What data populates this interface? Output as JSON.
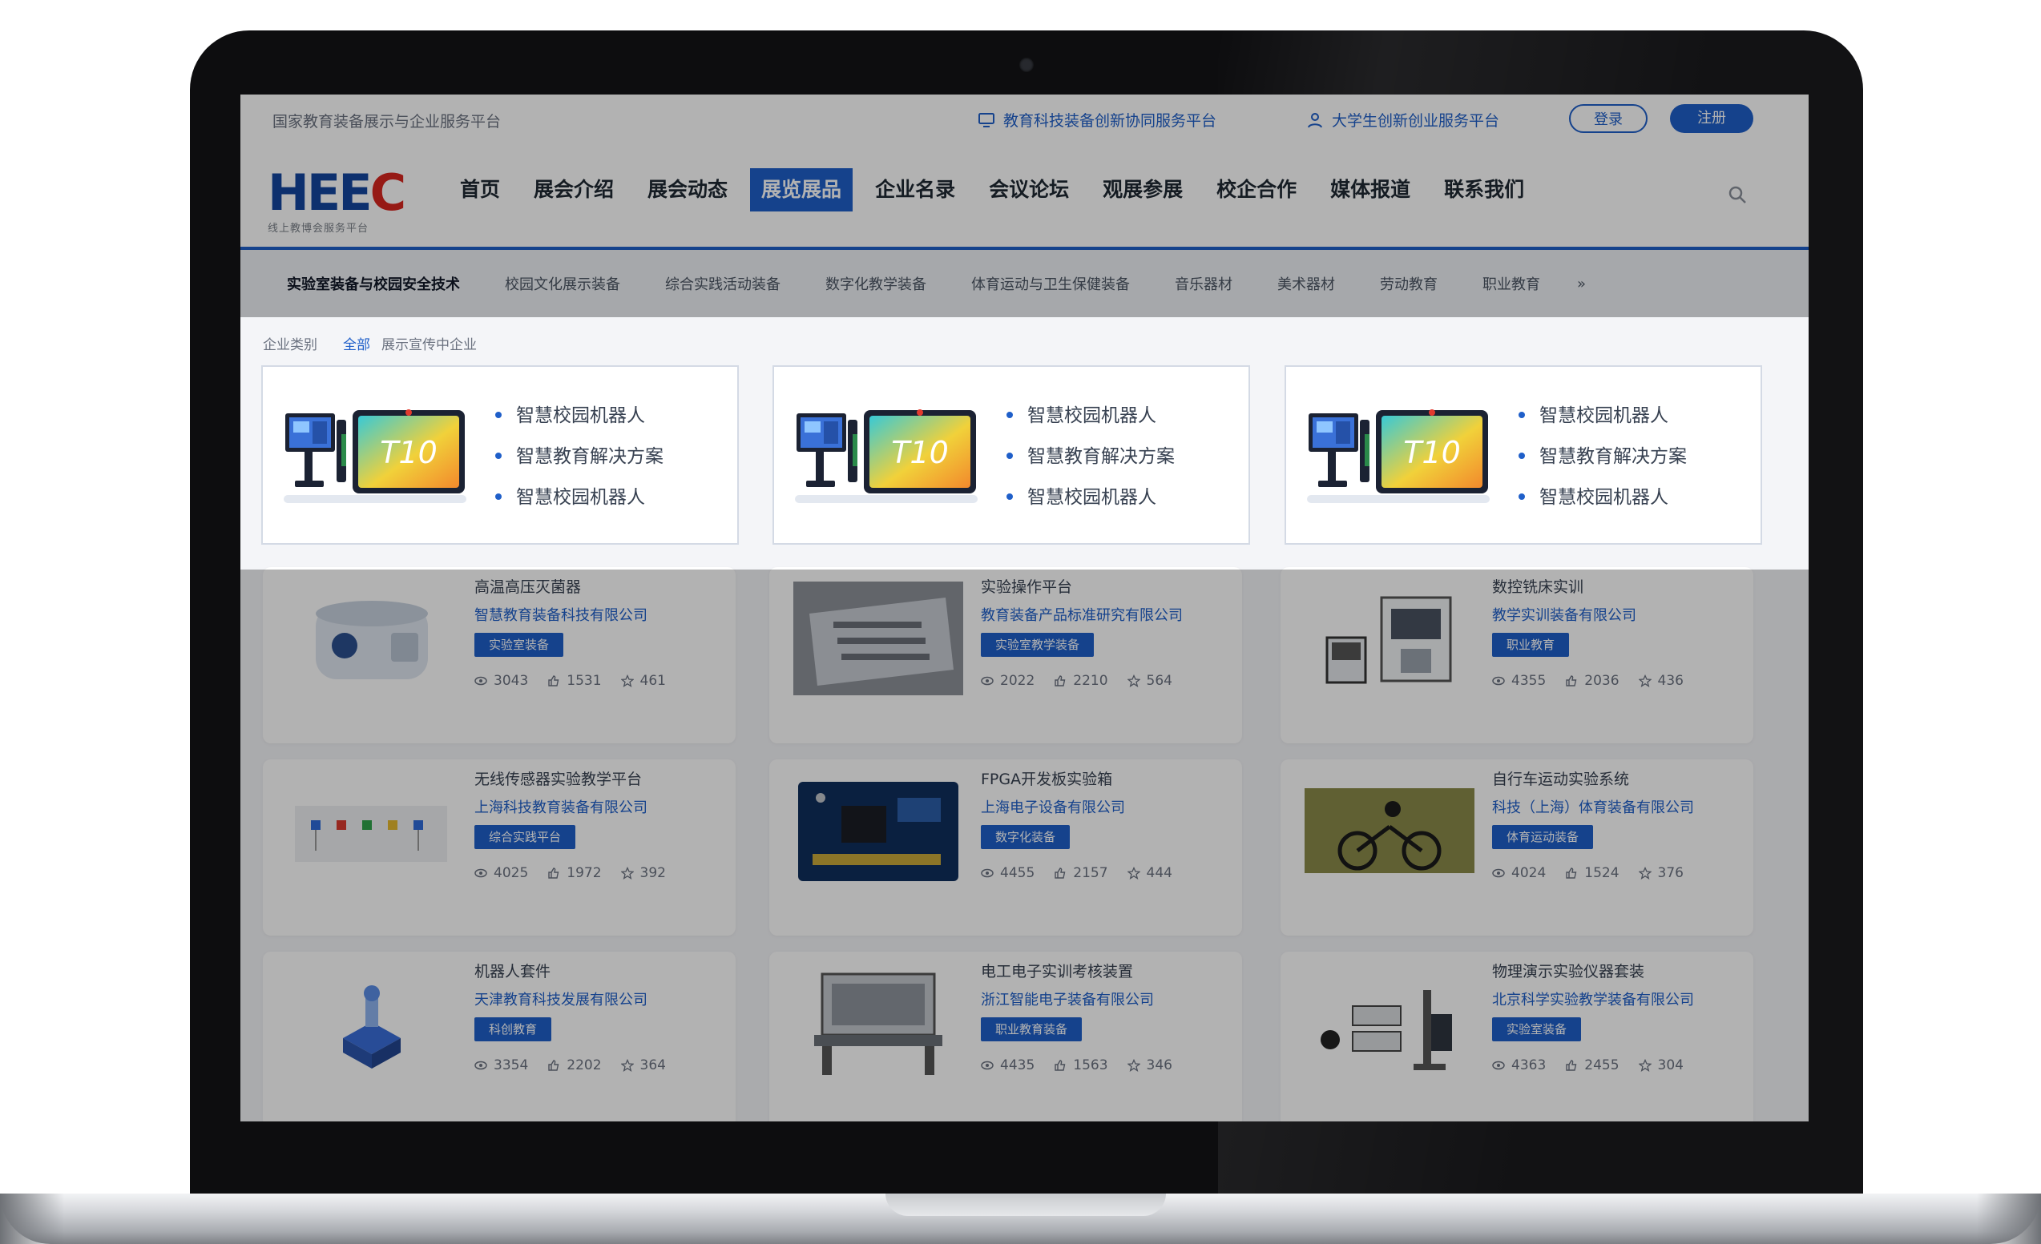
{
  "utility_bar": {
    "platform_name": "国家教育装备展示与企业服务平台",
    "link1": "教育科技装备创新协同服务平台",
    "link2": "大学生创新创业服务平台",
    "login": "登录",
    "register": "注册"
  },
  "logo": {
    "text_blue": "HEE",
    "text_red": "C",
    "subtitle": "线上教博会服务平台"
  },
  "nav": {
    "items": [
      "首页",
      "展会介绍",
      "展会动态",
      "展览展品",
      "企业名录",
      "会议论坛",
      "观展参展",
      "校企合作",
      "媒体报道",
      "联系我们"
    ],
    "active_index": 3
  },
  "subnav": {
    "items": [
      "实验室装备与校园安全技术",
      "校园文化展示装备",
      "综合实践活动装备",
      "数字化教学装备",
      "体育运动与卫生保健装备",
      "音乐器材",
      "美术器材",
      "劳动教育",
      "职业教育"
    ],
    "more": "»"
  },
  "breadcrumb": [
    "企业类别",
    "全部",
    "展示宣传中企业"
  ],
  "feature_cards": [
    {
      "badge": "T10",
      "items": [
        "智慧校园机器人",
        "智慧教育解决方案",
        "智慧校园机器人"
      ]
    },
    {
      "badge": "T10",
      "items": [
        "智慧校园机器人",
        "智慧教育解决方案",
        "智慧校园机器人"
      ]
    },
    {
      "badge": "T10",
      "items": [
        "智慧校园机器人",
        "智慧教育解决方案",
        "智慧校园机器人"
      ]
    }
  ],
  "products": [
    {
      "title": "高温高压灭菌器",
      "company": "智慧教育装备科技有限公司",
      "tag": "实验室装备",
      "views": "3043",
      "likes": "1531",
      "fav": "461"
    },
    {
      "title": "实验操作平台",
      "company": "教育装备产品标准研究有限公司",
      "tag": "实验室教学装备",
      "views": "2022",
      "likes": "2210",
      "fav": "564"
    },
    {
      "title": "数控铣床实训",
      "company": "教学实训装备有限公司",
      "tag": "职业教育",
      "views": "4355",
      "likes": "2036",
      "fav": "436"
    },
    {
      "title": "无线传感器实验教学平台",
      "company": "上海科技教育装备有限公司",
      "tag": "综合实践平台",
      "views": "4025",
      "likes": "1972",
      "fav": "392"
    },
    {
      "title": "FPGA开发板实验箱",
      "company": "上海电子设备有限公司",
      "tag": "数字化装备",
      "views": "4455",
      "likes": "2157",
      "fav": "444"
    },
    {
      "title": "自行车运动实验系统",
      "company": "科技（上海）体育装备有限公司",
      "tag": "体育运动装备",
      "views": "4024",
      "likes": "1524",
      "fav": "376"
    },
    {
      "title": "机器人套件",
      "company": "天津教育科技发展有限公司",
      "tag": "科创教育",
      "views": "3354",
      "likes": "2202",
      "fav": "364"
    },
    {
      "title": "电工电子实训考核装置",
      "company": "浙江智能电子装备有限公司",
      "tag": "职业教育装备",
      "views": "4435",
      "likes": "1563",
      "fav": "346"
    },
    {
      "title": "物理演示实验仪器套装",
      "company": "北京科学实验教学装备有限公司",
      "tag": "实验室装备",
      "views": "4363",
      "likes": "2455",
      "fav": "304"
    }
  ],
  "colors": {
    "primary": "#1f5fc9",
    "logo_blue": "#14469e",
    "logo_red": "#d7261f"
  }
}
